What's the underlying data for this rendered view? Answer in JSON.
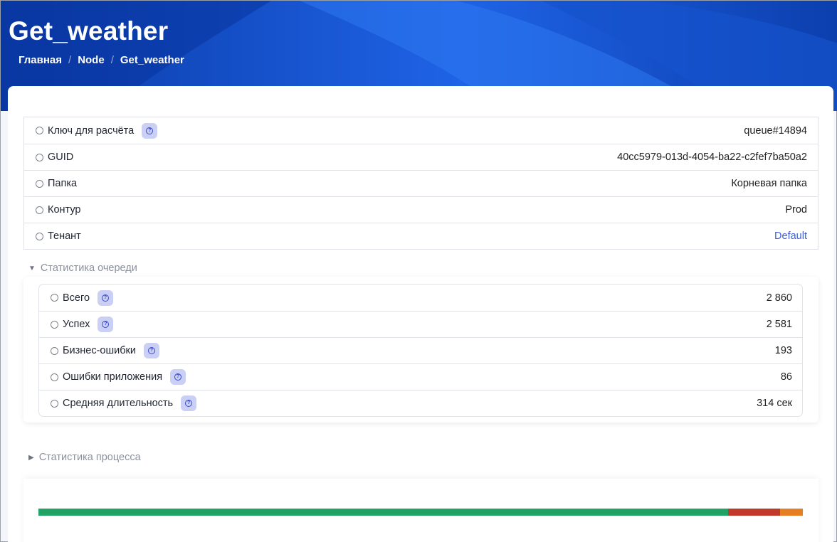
{
  "header": {
    "title": "Get_weather",
    "breadcrumb": [
      "Главная",
      "Node",
      "Get_weather"
    ]
  },
  "properties": [
    {
      "label": "Ключ для расчёта",
      "value": "queue#14894",
      "help": true
    },
    {
      "label": "GUID",
      "value": "40cc5979-013d-4054-ba22-c2fef7ba50a2",
      "help": false
    },
    {
      "label": "Папка",
      "value": "Корневая папка",
      "help": false
    },
    {
      "label": "Контур",
      "value": "Prod",
      "help": false
    },
    {
      "label": "Тенант",
      "value": "Default",
      "help": false,
      "link": true
    }
  ],
  "queue_stats": {
    "title": "Статистика очереди",
    "expanded": true,
    "rows": [
      {
        "label": "Всего",
        "value": "2 860"
      },
      {
        "label": "Успех",
        "value": "2 581"
      },
      {
        "label": "Бизнес-ошибки",
        "value": "193"
      },
      {
        "label": "Ошибки приложения",
        "value": "86"
      },
      {
        "label": "Средняя длительность",
        "value": "314 сек"
      }
    ]
  },
  "process_stats": {
    "title": "Статистика процесса",
    "expanded": false
  },
  "progress": {
    "segments": [
      {
        "name": "success",
        "value": 2581,
        "color": "#21a366"
      },
      {
        "name": "business-errors",
        "value": 193,
        "color": "#c0392b"
      },
      {
        "name": "app-errors",
        "value": 86,
        "color": "#e67e22"
      }
    ]
  },
  "colors": {
    "accent": "#0b43b8",
    "link": "#3c5fd6",
    "help_bg": "#c9cff5"
  }
}
